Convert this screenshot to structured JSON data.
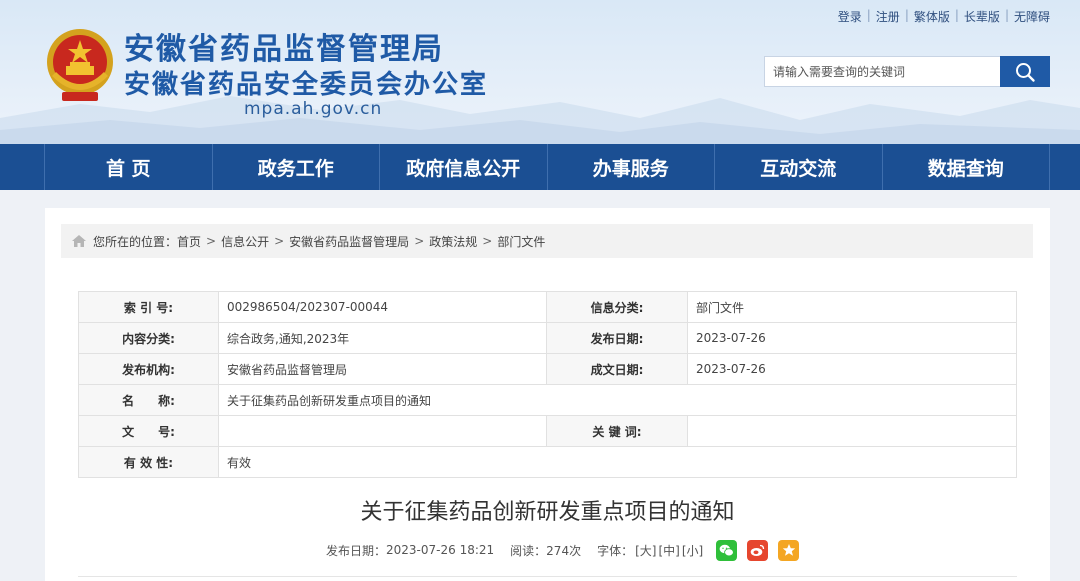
{
  "header": {
    "title_line1": "安徽省药品监督管理局",
    "title_line2": "安徽省药品安全委员会办公室",
    "domain": "mpa.ah.gov.cn",
    "top_links": [
      "登录",
      "注册",
      "繁体版",
      "长辈版",
      "无障碍"
    ],
    "search_placeholder": "请输入需要查询的关键词",
    "accent": "#1b4f93"
  },
  "nav": {
    "items": [
      "首  页",
      "政务工作",
      "政府信息公开",
      "办事服务",
      "互动交流",
      "数据查询"
    ]
  },
  "breadcrumb": {
    "prefix": "您所在的位置：",
    "items": [
      "首页",
      "信息公开",
      "安徽省药品监督管理局",
      "政策法规",
      "部门文件"
    ]
  },
  "meta": {
    "index_label": "索 引 号:",
    "index_value": "002986504/202307-00044",
    "category_label": "信息分类:",
    "category_value": "部门文件",
    "content_type_label": "内容分类:",
    "content_type_value": "综合政务,通知,2023年",
    "publish_date_label": "发布日期:",
    "publish_date_value": "2023-07-26",
    "org_label": "发布机构:",
    "org_value": "安徽省药品监督管理局",
    "written_date_label": "成文日期:",
    "written_date_value": "2023-07-26",
    "name_label": "名　　称:",
    "name_value": "关于征集药品创新研发重点项目的通知",
    "doc_no_label": "文　　号:",
    "doc_no_value": "",
    "keywords_label": "关 键 词:",
    "keywords_value": "",
    "validity_label": "有 效 性:",
    "validity_value": "有效"
  },
  "article": {
    "title": "关于征集药品创新研发重点项目的通知",
    "publish_label": "发布日期：",
    "publish_time": "2023-07-26 18:21",
    "views_label": "阅读：",
    "views_value": "274次",
    "font_label": "字体：",
    "font_large": "[大]",
    "font_medium": "[中]",
    "font_small": "[小]"
  }
}
